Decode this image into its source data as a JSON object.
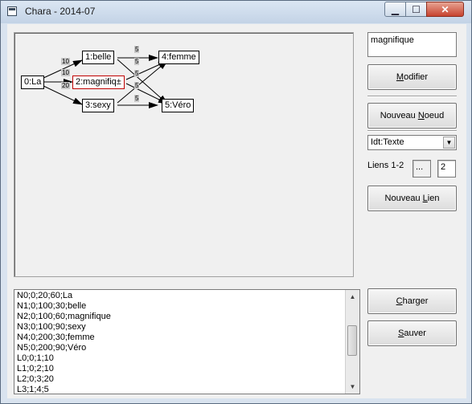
{
  "window": {
    "title": "Chara - 2014-07",
    "minimize_glyph": "▁",
    "maximize_glyph": "☐",
    "close_glyph": "✕"
  },
  "graph": {
    "nodes": [
      {
        "label": "0:La"
      },
      {
        "label": "1:belle"
      },
      {
        "label": "2:magnifiq±"
      },
      {
        "label": "3:sexy"
      },
      {
        "label": "4:femme"
      },
      {
        "label": "5:Véro"
      }
    ],
    "weights": [
      "10",
      "10",
      "20",
      "5",
      "5",
      "5",
      "5",
      "5"
    ]
  },
  "node_text": "magnifique",
  "buttons": {
    "modifier": {
      "pre": "",
      "key": "M",
      "post": "odifier"
    },
    "nouveau_noeud": {
      "pre": "Nouveau ",
      "key": "N",
      "post": "oeud"
    },
    "nouveau_lien": {
      "pre": "Nouveau ",
      "key": "L",
      "post": "ien"
    },
    "charger": {
      "pre": "",
      "key": "C",
      "post": "harger"
    },
    "sauver": {
      "pre": "",
      "key": "S",
      "post": "auver"
    }
  },
  "type_select": {
    "value": "Idt:Texte",
    "arrow": "▼"
  },
  "links": {
    "label": "Liens 1-2",
    "value1": "...",
    "value2": "2"
  },
  "list": {
    "lines": [
      "N0;0;20;60;La",
      "N1;0;100;30;belle",
      "N2;0;100;60;magnifique",
      "N3;0;100;90;sexy",
      "N4;0;200;30;femme",
      "N5;0;200;90;Véro",
      "L0;0;1;10",
      "L1;0;2;10",
      "L2;0;3;20",
      "L3;1;4;5"
    ],
    "scroll_up": "▲",
    "scroll_down": "▼"
  }
}
